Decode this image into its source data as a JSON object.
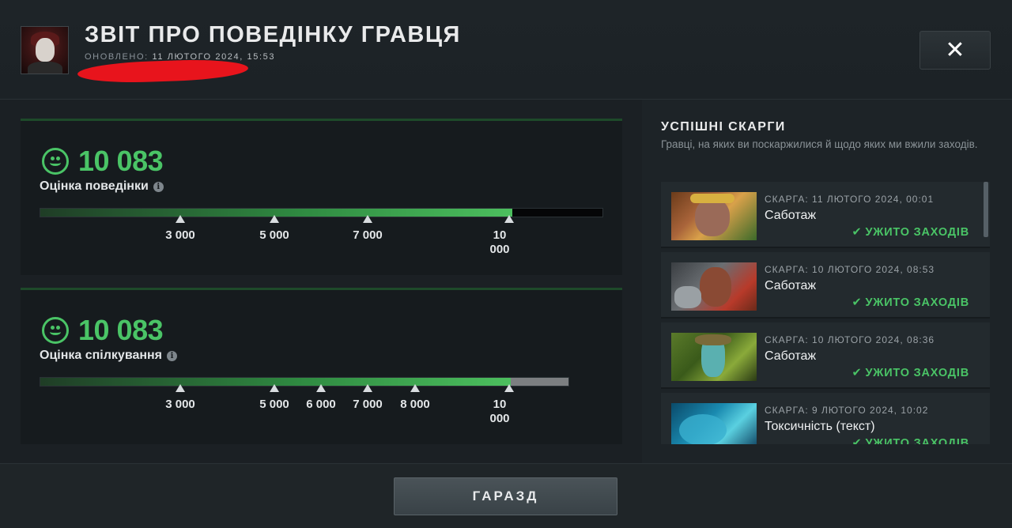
{
  "header": {
    "title": "ЗВІТ ПРО ПОВЕДІНКУ ГРАВЦЯ",
    "updated_label": "ОНОВЛЕНО:",
    "updated_value": "11 ЛЮТОГО 2024, 15:53",
    "close_icon": "✕"
  },
  "behavior": {
    "score": "10 083",
    "label": "Оцінка поведінки",
    "fill_fraction": 0.84,
    "ticks": [
      "3 000",
      "5 000",
      "7 000",
      "10 000"
    ]
  },
  "communication": {
    "score": "10 083",
    "label": "Оцінка спілкування",
    "fill_fraction": 0.89,
    "ticks": [
      "3 000",
      "5 000",
      "6 000",
      "7 000",
      "8 000",
      "10 000"
    ]
  },
  "reports_panel": {
    "title": "УСПІШНІ СКАРГИ",
    "subtitle": "Гравці, на яких ви поскаржилися й щодо яких ми вжили заходів.",
    "items": [
      {
        "meta": "СКАРГА: 11 ЛЮТОГО 2024, 00:01",
        "reason": "Саботаж",
        "status": "УЖИТО ЗАХОДІВ"
      },
      {
        "meta": "СКАРГА: 10 ЛЮТОГО 2024, 08:53",
        "reason": "Саботаж",
        "status": "УЖИТО ЗАХОДІВ"
      },
      {
        "meta": "СКАРГА: 10 ЛЮТОГО 2024, 08:36",
        "reason": "Саботаж",
        "status": "УЖИТО ЗАХОДІВ"
      },
      {
        "meta": "СКАРГА: 9 ЛЮТОГО 2024, 10:02",
        "reason": "Токсичність (текст)",
        "status": "УЖИТО ЗАХОДІВ"
      }
    ]
  },
  "footer": {
    "ok_label": "ГАРАЗД"
  },
  "colors": {
    "accent_green": "#4ac466",
    "redaction": "#e8141c"
  }
}
